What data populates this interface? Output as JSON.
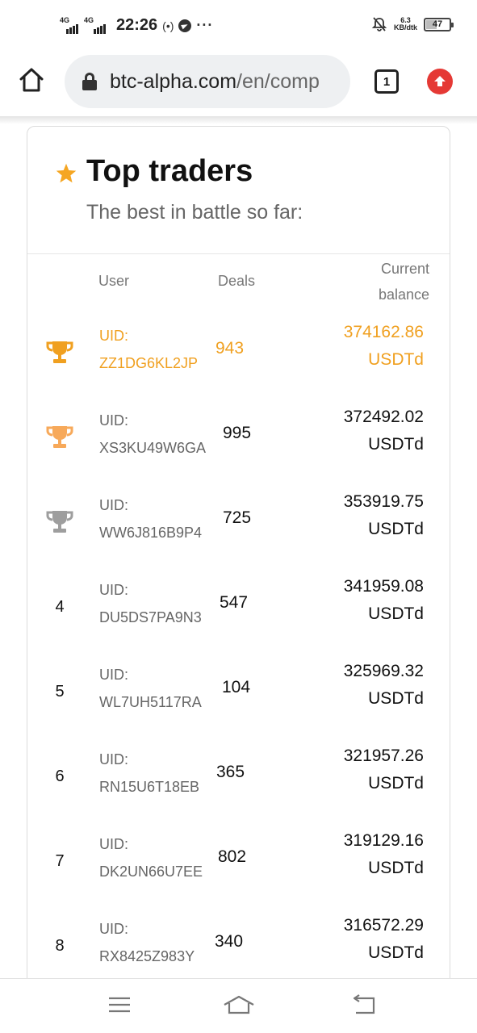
{
  "status_bar": {
    "net1": "4G",
    "net2": "4G",
    "time": "22:26",
    "hotspot_icon": "(•)",
    "telegram_icon": "telegram-icon",
    "more_icon": "···",
    "mute_icon": "bell-off-icon",
    "speed_value": "6.3",
    "speed_unit": "KB/dtk",
    "battery": "47",
    "battery_fraction": 0.47
  },
  "browser": {
    "url_domain": "btc-alpha.com",
    "url_path": "/en/comp",
    "tab_count": "1",
    "home_icon": "home-icon",
    "lock_icon": "lock-icon",
    "update_icon": "update-arrow-icon"
  },
  "card": {
    "title": "Top traders",
    "subtitle": "The best in battle so far:",
    "columns": {
      "user": "User",
      "deals": "Deals",
      "balance_line1": "Current",
      "balance_line2": "balance"
    },
    "rows": [
      {
        "rank": "",
        "trophy": "gold",
        "uid_label": "UID:",
        "uid": "ZZ1DG6KL2JP",
        "deals": "943",
        "balance": "374162.86",
        "unit": "USDTd"
      },
      {
        "rank": "",
        "trophy": "bronze",
        "uid_label": "UID:",
        "uid": "XS3KU49W6GA",
        "deals": "995",
        "balance": "372492.02",
        "unit": "USDTd"
      },
      {
        "rank": "",
        "trophy": "silver",
        "uid_label": "UID:",
        "uid": "WW6J816B9P4",
        "deals": "725",
        "balance": "353919.75",
        "unit": "USDTd"
      },
      {
        "rank": "4",
        "trophy": "",
        "uid_label": "UID:",
        "uid": "DU5DS7PA9N3",
        "deals": "547",
        "balance": "341959.08",
        "unit": "USDTd"
      },
      {
        "rank": "5",
        "trophy": "",
        "uid_label": "UID:",
        "uid": "WL7UH5117RA",
        "deals": "104",
        "balance": "325969.32",
        "unit": "USDTd"
      },
      {
        "rank": "6",
        "trophy": "",
        "uid_label": "UID:",
        "uid": "RN15U6T18EB",
        "deals": "365",
        "balance": "321957.26",
        "unit": "USDTd"
      },
      {
        "rank": "7",
        "trophy": "",
        "uid_label": "UID:",
        "uid": "DK2UN66U7EE",
        "deals": "802",
        "balance": "319129.16",
        "unit": "USDTd"
      },
      {
        "rank": "8",
        "trophy": "",
        "uid_label": "UID:",
        "uid": "RX8425Z983Y",
        "deals": "340",
        "balance": "316572.29",
        "unit": "USDTd"
      }
    ]
  },
  "colors": {
    "gold": "#f0a020",
    "bronze": "#f7a95a",
    "silver": "#9e9e9e",
    "star": "#f5a623",
    "update": "#e53935"
  },
  "nav": {
    "menu_icon": "menu-icon",
    "home_icon": "nav-home-icon",
    "back_icon": "back-icon"
  }
}
